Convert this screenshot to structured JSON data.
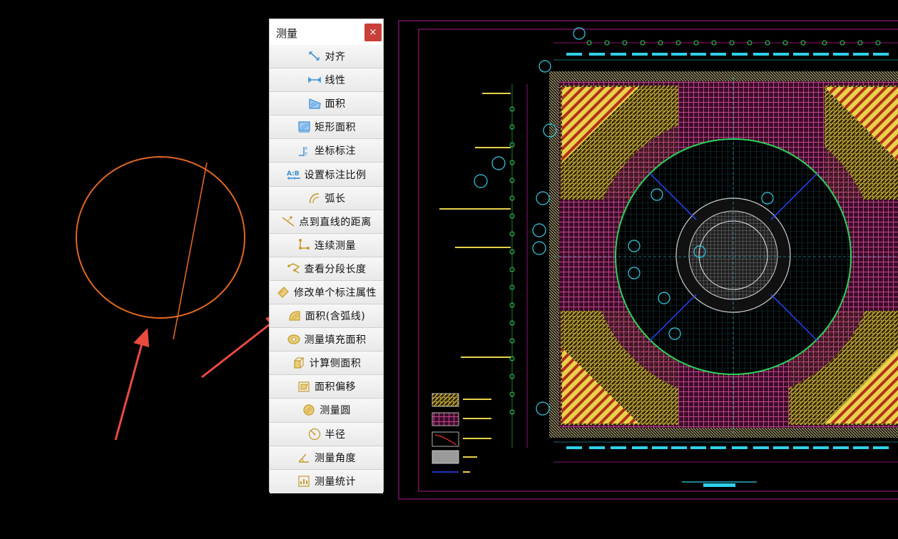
{
  "panel": {
    "title": "测量",
    "close_label": "×"
  },
  "tools": [
    {
      "label": "对齐",
      "icon": "align-measure-icon"
    },
    {
      "label": "线性",
      "icon": "linear-measure-icon"
    },
    {
      "label": "面积",
      "icon": "area-icon"
    },
    {
      "label": "矩形面积",
      "icon": "rectangle-area-icon"
    },
    {
      "label": "坐标标注",
      "icon": "coordinate-annotation-icon"
    },
    {
      "label": "设置标注比例",
      "icon": "annotation-scale-icon"
    },
    {
      "label": "弧长",
      "icon": "arc-length-icon"
    },
    {
      "label": "点到直线的距离",
      "icon": "point-to-line-icon"
    },
    {
      "label": "连续测量",
      "icon": "continuous-measure-icon"
    },
    {
      "label": "查看分段长度",
      "icon": "segment-length-icon"
    },
    {
      "label": "修改单个标注属性",
      "icon": "edit-annotation-icon"
    },
    {
      "label": "面积(含弧线)",
      "icon": "arc-area-icon"
    },
    {
      "label": "测量填充面积",
      "icon": "fill-area-icon"
    },
    {
      "label": "计算侧面积",
      "icon": "side-area-icon"
    },
    {
      "label": "面积偏移",
      "icon": "area-offset-icon"
    },
    {
      "label": "测量圆",
      "icon": "measure-circle-icon"
    },
    {
      "label": "半径",
      "icon": "radius-icon"
    },
    {
      "label": "测量角度",
      "icon": "angle-icon"
    },
    {
      "label": "测量统计",
      "icon": "statistics-icon"
    }
  ],
  "colors": {
    "canvas_bg": "#000000",
    "sketch_orange": "#e0661e",
    "arrow_red": "#ea4a3e",
    "frame_magenta": "#b01a8e",
    "cad_cyan": "#2fd0e8",
    "cad_yellow": "#e8d24a",
    "cad_pink": "#c2448a",
    "cad_green": "#2ad25a",
    "cad_blue": "#2244ff",
    "close_red": "#c9403a"
  }
}
